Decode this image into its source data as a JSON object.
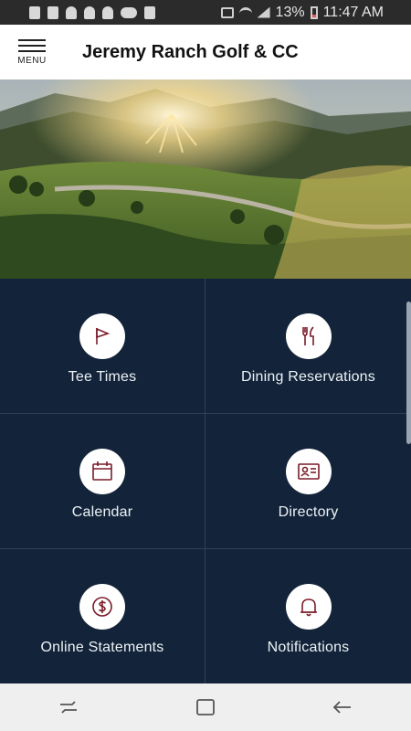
{
  "status_bar": {
    "battery": "13%",
    "time": "11:47 AM"
  },
  "header": {
    "menu_label": "MENU",
    "title": "Jeremy Ranch Golf & CC"
  },
  "tiles": [
    {
      "label": "Tee Times",
      "icon": "flag-icon"
    },
    {
      "label": "Dining Reservations",
      "icon": "fork-knife-icon"
    },
    {
      "label": "Calendar",
      "icon": "calendar-icon"
    },
    {
      "label": "Directory",
      "icon": "id-card-icon"
    },
    {
      "label": "Online Statements",
      "icon": "dollar-icon"
    },
    {
      "label": "Notifications",
      "icon": "bell-icon"
    }
  ],
  "colors": {
    "tile_bg": "#13243a",
    "icon_stroke": "#7a1c2a",
    "header_bg": "#ffffff"
  }
}
